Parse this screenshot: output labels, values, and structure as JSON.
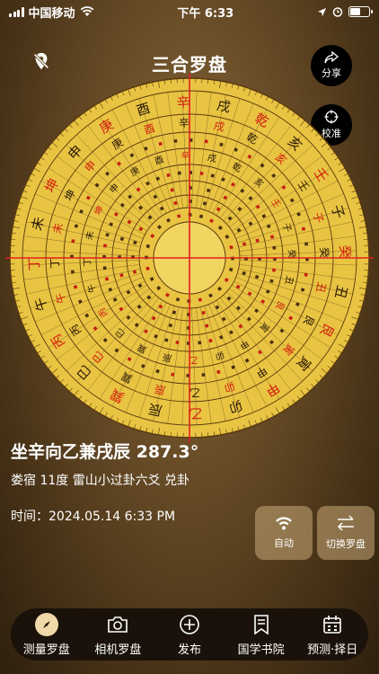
{
  "status": {
    "carrier": "中国移动",
    "time": "下午 6:33"
  },
  "header": {
    "title": "三合罗盘",
    "share_label": "分享",
    "calibrate_label": "校准"
  },
  "compass": {
    "outer_ring": [
      "卯",
      "乙",
      "辰",
      "巽",
      "巳",
      "丙",
      "午",
      "丁",
      "未",
      "坤",
      "申",
      "庚",
      "酉",
      "辛",
      "戌",
      "乾",
      "亥",
      "壬",
      "子",
      "癸",
      "丑",
      "艮",
      "寅",
      "甲"
    ],
    "middle_ring": [
      "卯",
      "乙",
      "辰",
      "巽",
      "巳",
      "丙",
      "午",
      "丁",
      "未",
      "坤",
      "申",
      "庚",
      "酉",
      "辛",
      "戌",
      "乾",
      "亥",
      "壬",
      "子",
      "癸",
      "丑",
      "艮",
      "寅",
      "甲"
    ],
    "inner_ring": [
      "卯",
      "乙",
      "辰",
      "巽",
      "巳",
      "丙",
      "午",
      "丁",
      "未",
      "坤",
      "申",
      "庚",
      "酉",
      "辛",
      "戌",
      "乾",
      "亥",
      "壬",
      "子",
      "癸",
      "丑",
      "艮",
      "寅",
      "甲"
    ],
    "heading_deg": 287.3,
    "dial_color": "#e8c442",
    "line_color": "#e02020"
  },
  "reading": {
    "direction": "坐辛向乙兼戌辰 287.3°",
    "details": "娄宿 11度  雷山小过卦六爻  兑卦",
    "time_label": "时间：",
    "time_value": "2024.05.14 6:33 PM"
  },
  "actions": {
    "auto_label": "自动",
    "switch_label": "切换罗盘"
  },
  "tabs": [
    {
      "label": "测量罗盘",
      "icon": "compass-icon"
    },
    {
      "label": "相机罗盘",
      "icon": "camera-icon"
    },
    {
      "label": "发布",
      "icon": "plus-icon"
    },
    {
      "label": "国学书院",
      "icon": "bookmark-icon"
    },
    {
      "label": "预测·择日",
      "icon": "calendar-icon"
    }
  ]
}
